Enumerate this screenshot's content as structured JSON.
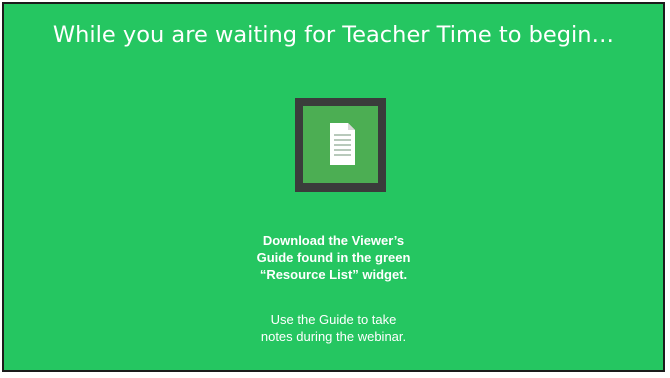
{
  "slide": {
    "title": "While you are waiting for Teacher Time to begin…",
    "icon": "document-icon",
    "instruction_lines": [
      "Download the Viewer’s",
      "Guide found in the green",
      "“Resource List” widget."
    ],
    "note_lines": [
      "Use the Guide to take",
      "notes during the webinar."
    ]
  },
  "colors": {
    "background": "#25c661",
    "icon_frame": "#3a3c3b",
    "icon_tile": "#4cae53",
    "text": "#ffffff"
  }
}
